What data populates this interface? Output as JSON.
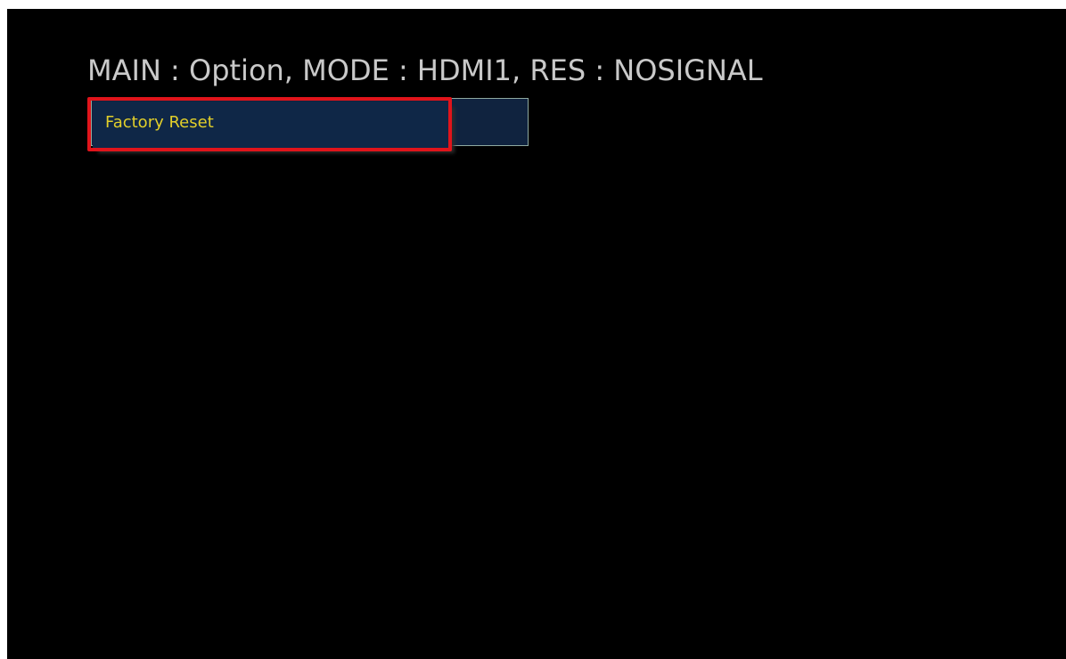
{
  "header": {
    "status": "MAIN : Option, MODE : HDMI1, RES : NOSIGNAL"
  },
  "menu": {
    "items": [
      {
        "label": "Factory Reset"
      }
    ]
  },
  "colors": {
    "background": "#000000",
    "header_text": "#c9c9c9",
    "menu_bg": "#0f2747",
    "menu_text": "#e2cf2a",
    "highlight": "#e0141b"
  }
}
